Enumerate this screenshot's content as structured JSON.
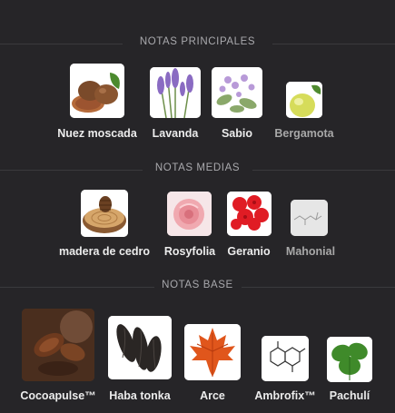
{
  "sections": {
    "principales": {
      "title": "NOTAS PRINCIPALES",
      "notes": [
        {
          "label": "Nuez moscada",
          "icon": "nutmeg-icon"
        },
        {
          "label": "Lavanda",
          "icon": "lavender-icon"
        },
        {
          "label": "Sabio",
          "icon": "sage-icon"
        },
        {
          "label": "Bergamota",
          "icon": "bergamot-icon"
        }
      ]
    },
    "medias": {
      "title": "NOTAS MEDIAS",
      "notes": [
        {
          "label": "madera de cedro",
          "icon": "cedar-wood-icon"
        },
        {
          "label": "Rosyfolia",
          "icon": "rose-icon"
        },
        {
          "label": "Geranio",
          "icon": "geranium-icon"
        },
        {
          "label": "Mahonial",
          "icon": "molecule-icon"
        }
      ]
    },
    "base": {
      "title": "NOTAS BASE",
      "notes": [
        {
          "label": "Cocoapulse™",
          "icon": "cocoa-icon"
        },
        {
          "label": "Haba tonka",
          "icon": "tonka-bean-icon"
        },
        {
          "label": "Arce",
          "icon": "maple-leaf-icon"
        },
        {
          "label": "Ambrofix™",
          "icon": "molecule-icon"
        },
        {
          "label": "Pachulí",
          "icon": "patchouli-icon"
        }
      ]
    }
  },
  "colors": {
    "background": "#262528",
    "divider": "#3a3a3d",
    "heading": "#a9a9ad",
    "label": "#ececec"
  }
}
